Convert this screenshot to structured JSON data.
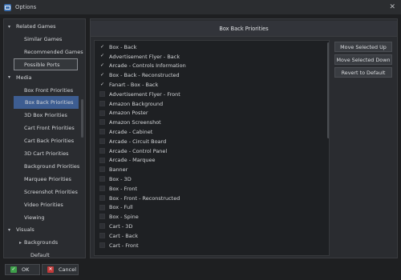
{
  "window": {
    "title": "Options"
  },
  "sidebar": {
    "items": [
      {
        "label": "Related Games",
        "level": 0,
        "expanded": true,
        "state": ""
      },
      {
        "label": "Similar Games",
        "level": 1,
        "state": ""
      },
      {
        "label": "Recommended Games",
        "level": 1,
        "state": ""
      },
      {
        "label": "Possible Ports",
        "level": 1,
        "state": "boxed"
      },
      {
        "label": "Media",
        "level": 0,
        "expanded": true,
        "state": ""
      },
      {
        "label": "Box Front Priorities",
        "level": 1,
        "state": ""
      },
      {
        "label": "Box Back Priorities",
        "level": 1,
        "state": "selected"
      },
      {
        "label": "3D Box Priorities",
        "level": 1,
        "state": ""
      },
      {
        "label": "Cart Front Priorities",
        "level": 1,
        "state": ""
      },
      {
        "label": "Cart Back Priorities",
        "level": 1,
        "state": ""
      },
      {
        "label": "3D Cart Priorities",
        "level": 1,
        "state": ""
      },
      {
        "label": "Background Priorities",
        "level": 1,
        "state": ""
      },
      {
        "label": "Marquee Priorities",
        "level": 1,
        "state": ""
      },
      {
        "label": "Screenshot Priorities",
        "level": 1,
        "state": ""
      },
      {
        "label": "Video Priorities",
        "level": 1,
        "state": ""
      },
      {
        "label": "Viewing",
        "level": 1,
        "state": ""
      },
      {
        "label": "Visuals",
        "level": 0,
        "expanded": true,
        "state": ""
      },
      {
        "label": "Backgrounds",
        "level": 1,
        "expanded": true,
        "state": ""
      },
      {
        "label": "Default",
        "level": 2,
        "state": ""
      }
    ]
  },
  "main": {
    "header": "Box Back Priorities",
    "list": [
      {
        "label": "Box - Back",
        "checked": true
      },
      {
        "label": "Advertisement Flyer - Back",
        "checked": true
      },
      {
        "label": "Arcade - Controls Information",
        "checked": true
      },
      {
        "label": "Box - Back - Reconstructed",
        "checked": true
      },
      {
        "label": "Fanart - Box - Back",
        "checked": true
      },
      {
        "label": "Advertisement Flyer - Front",
        "checked": false
      },
      {
        "label": "Amazon Background",
        "checked": false
      },
      {
        "label": "Amazon Poster",
        "checked": false
      },
      {
        "label": "Amazon Screenshot",
        "checked": false
      },
      {
        "label": "Arcade - Cabinet",
        "checked": false
      },
      {
        "label": "Arcade - Circuit Board",
        "checked": false
      },
      {
        "label": "Arcade - Control Panel",
        "checked": false
      },
      {
        "label": "Arcade - Marquee",
        "checked": false
      },
      {
        "label": "Banner",
        "checked": false
      },
      {
        "label": "Box - 3D",
        "checked": false
      },
      {
        "label": "Box - Front",
        "checked": false
      },
      {
        "label": "Box - Front - Reconstructed",
        "checked": false
      },
      {
        "label": "Box - Full",
        "checked": false
      },
      {
        "label": "Box - Spine",
        "checked": false
      },
      {
        "label": "Cart - 3D",
        "checked": false
      },
      {
        "label": "Cart - Back",
        "checked": false
      },
      {
        "label": "Cart - Front",
        "checked": false
      }
    ],
    "buttons": {
      "move_up": "Move Selected Up",
      "move_down": "Move Selected Down",
      "revert": "Revert to Default"
    }
  },
  "footer": {
    "ok": "OK",
    "cancel": "Cancel"
  },
  "icons": {
    "close": "close-icon",
    "expanded": "caret-down-icon",
    "check": "checkmark-icon"
  },
  "colors": {
    "selection": "#3d5d91",
    "ok": "#3ea04a",
    "cancel": "#c23a3a"
  }
}
